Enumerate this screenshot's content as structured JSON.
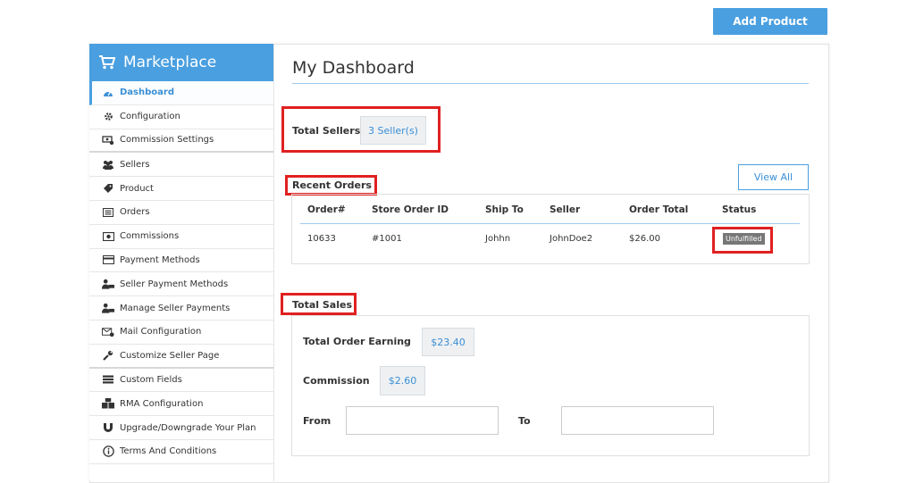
{
  "header": {
    "add_product_label": "Add Product"
  },
  "sidebar": {
    "title": "Marketplace",
    "items": [
      {
        "label": "Dashboard",
        "icon": "dashboard-icon"
      },
      {
        "label": "Configuration",
        "icon": "gear-icon"
      },
      {
        "label": "Commission Settings",
        "icon": "commission-settings-icon"
      },
      {
        "label": "Sellers",
        "icon": "users-icon"
      },
      {
        "label": "Product",
        "icon": "tag-icon"
      },
      {
        "label": "Orders",
        "icon": "list-icon"
      },
      {
        "label": "Commissions",
        "icon": "money-icon"
      },
      {
        "label": "Payment Methods",
        "icon": "credit-card-icon"
      },
      {
        "label": "Seller Payment Methods",
        "icon": "user-card-icon"
      },
      {
        "label": "Manage Seller Payments",
        "icon": "user-card-icon"
      },
      {
        "label": "Mail Configuration",
        "icon": "mail-gear-icon"
      },
      {
        "label": "Customize Seller Page",
        "icon": "wrench-icon"
      },
      {
        "label": "Custom Fields",
        "icon": "fields-icon"
      },
      {
        "label": "RMA Configuration",
        "icon": "boxes-icon"
      },
      {
        "label": "Upgrade/Downgrade Your Plan",
        "icon": "magnet-icon"
      },
      {
        "label": "Terms And Conditions",
        "icon": "info-icon"
      }
    ]
  },
  "main": {
    "title": "My Dashboard",
    "total_sellers_label": "Total Sellers",
    "total_sellers_value": "3 Seller(s)",
    "recent_orders_label": "Recent Orders",
    "view_all_label": "View All",
    "orders_table": {
      "headers": [
        "Order#",
        "Store Order ID",
        "Ship To",
        "Seller",
        "Order Total",
        "Status"
      ],
      "rows": [
        {
          "order": "10633",
          "store_order_id": "#1001",
          "ship_to": "Johhn",
          "seller": "JohnDoe2",
          "total": "$26.00",
          "status": "Unfulfilled"
        }
      ]
    },
    "total_sales_label": "Total Sales",
    "total_order_earning_label": "Total Order Earning",
    "total_order_earning_value": "$23.40",
    "commission_label": "Commission",
    "commission_value": "$2.60",
    "from_label": "From",
    "to_label": "To"
  },
  "colors": {
    "accent": "#4a9fe0",
    "highlight": "#e02020",
    "badge": "#777777"
  }
}
